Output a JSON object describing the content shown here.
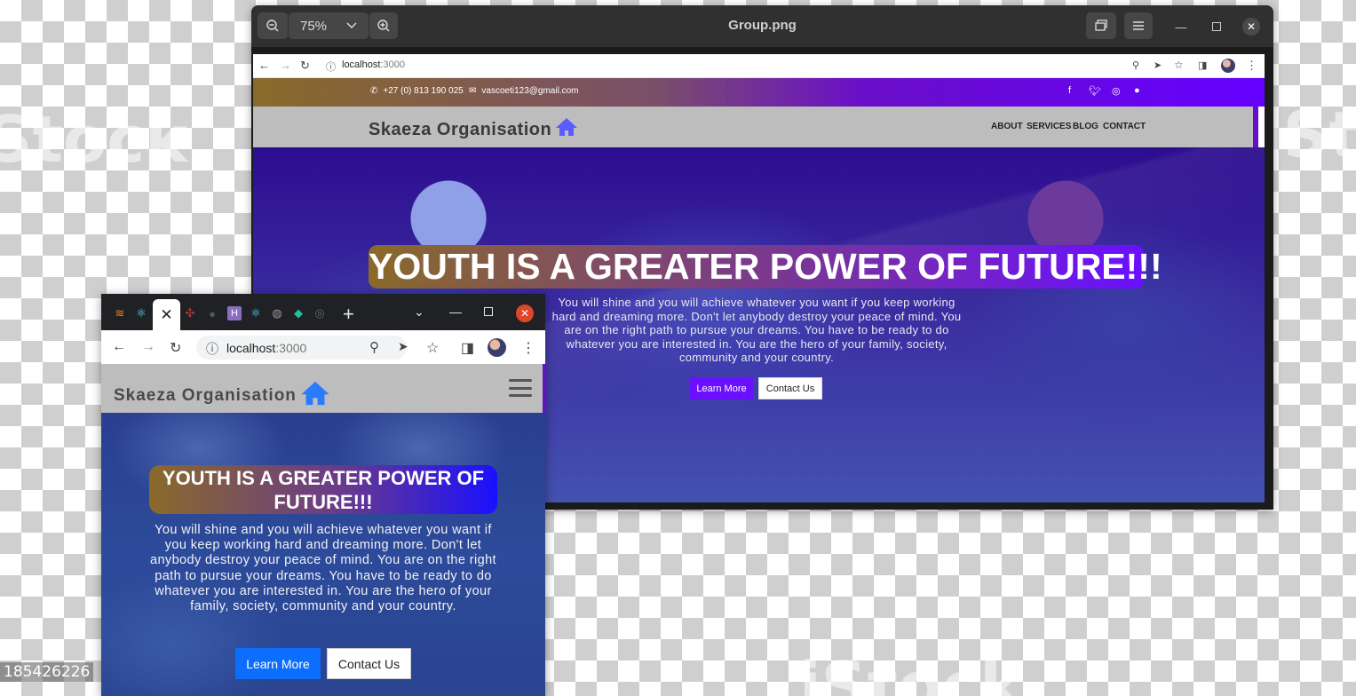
{
  "viewer": {
    "title": "Group.png",
    "zoom": "75%",
    "zoom_out_icon": "zoom-out-icon",
    "zoom_in_icon": "zoom-in-icon"
  },
  "desktop": {
    "url_host": "localhost",
    "url_port": ":3000",
    "phone": "+27 (0) 813 190 025",
    "email": "vascoeti123@gmail.com",
    "brand": "Skaeza Organisation",
    "menu": [
      "ABOUT",
      "SERVICES",
      "BLOG",
      "CONTACT"
    ],
    "heading": "YOUTH IS A GREATER POWER OF FUTURE!!!",
    "paragraph": "You will shine and you will achieve whatever you want if you keep working hard and dreaming more. Don't let anybody destroy your peace of mind. You are on the right path to pursue your dreams. You have to be ready to do whatever you are interested in. You are the hero of your family, society, community and your country.",
    "learn_more": "Learn More",
    "contact_us": "Contact Us",
    "accent": "#6a0fff"
  },
  "mobile": {
    "url_host": "localhost",
    "url_port": ":3000",
    "brand": "Skaeza Organisation",
    "heading": "YOUTH IS A GREATER POWER OF FUTURE!!!",
    "paragraph": "You will shine and you will achieve whatever you want if you keep working hard and dreaming more. Don't let anybody destroy your peace of mind. You are on the right path to pursue your dreams. You have to be ready to do whatever you are interested in. You are the hero of your family, society, community and your country.",
    "learn_more": "Learn More",
    "contact_us": "Contact Us",
    "accent": "#0d6efd"
  },
  "watermark": {
    "stock_id": "185426226",
    "text": "iStock"
  }
}
